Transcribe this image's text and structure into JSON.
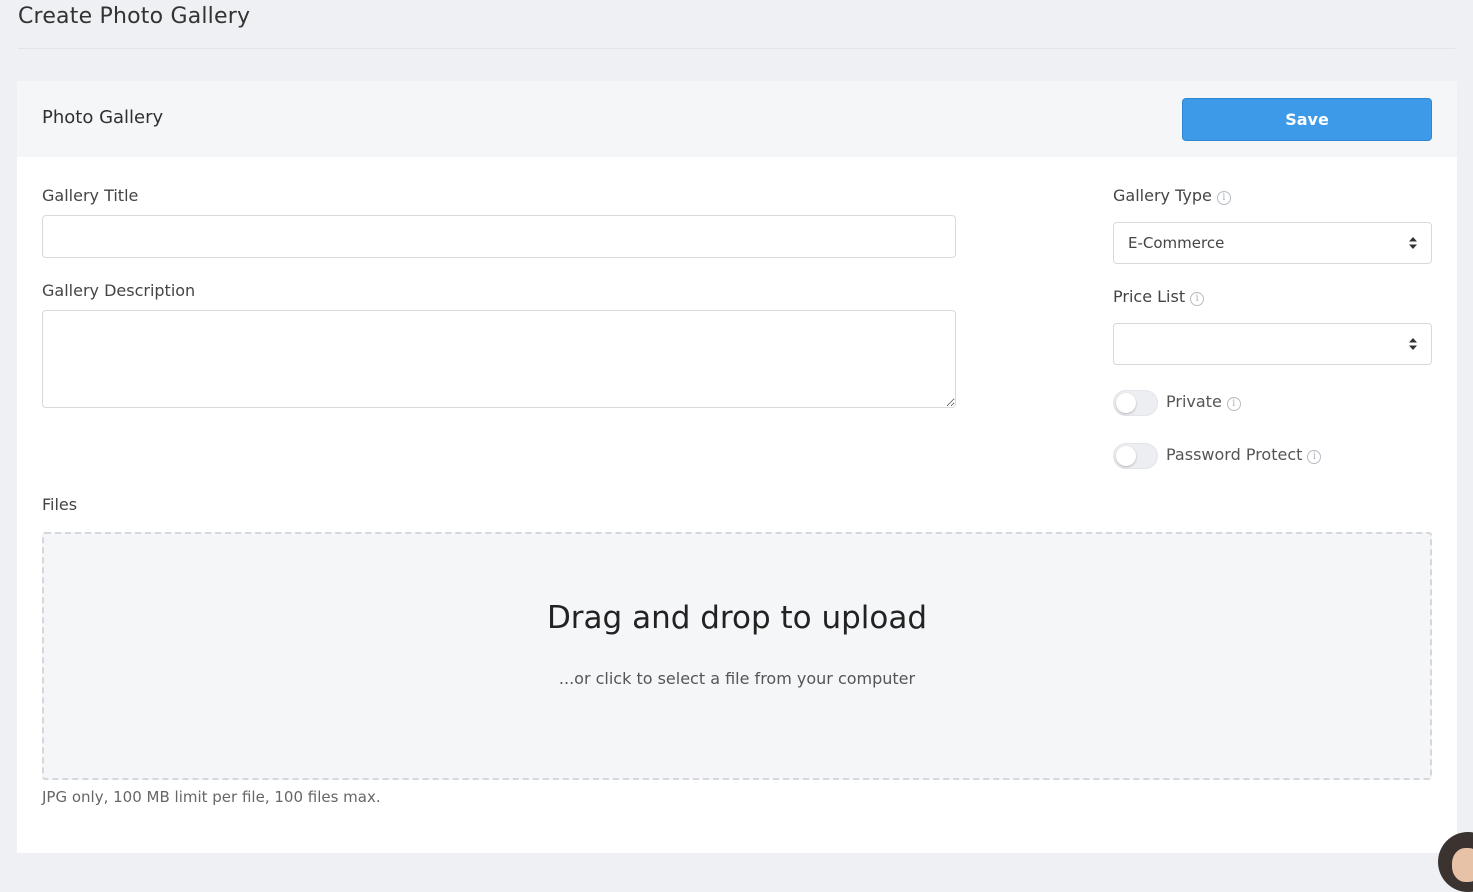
{
  "page": {
    "title": "Create Photo Gallery"
  },
  "card": {
    "title": "Photo Gallery",
    "save_label": "Save"
  },
  "form": {
    "gallery_title_label": "Gallery Title",
    "gallery_title_value": "",
    "gallery_description_label": "Gallery Description",
    "gallery_description_value": "",
    "gallery_type_label": "Gallery Type",
    "gallery_type_value": "E-Commerce",
    "price_list_label": "Price List",
    "price_list_value": "",
    "private_label": "Private",
    "private_enabled": false,
    "password_protect_label": "Password Protect",
    "password_protect_enabled": false,
    "files_label": "Files"
  },
  "dropzone": {
    "title": "Drag and drop to upload",
    "subtitle": "...or click to select a file from your computer",
    "hint": "JPG only, 100 MB limit per file, 100 files max."
  },
  "colors": {
    "accent": "#3d9ae8",
    "background": "#eef0f4",
    "card_header": "#f5f6f8"
  },
  "icons": {
    "info": "info-circle-icon",
    "select_arrows": "sort-arrows-icon"
  }
}
